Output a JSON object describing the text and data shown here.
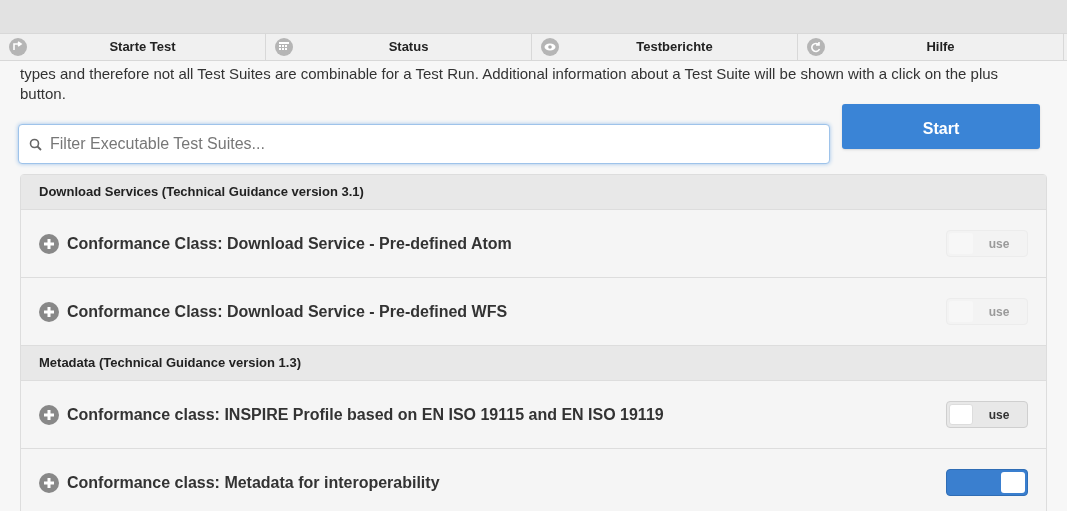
{
  "tabs": [
    {
      "label": "Starte Test"
    },
    {
      "label": "Status"
    },
    {
      "label": "Testberichte"
    },
    {
      "label": "Hilfe"
    }
  ],
  "intro": "types and therefore not all Test Suites are combinable for a Test Run. Additional information about a Test Suite will be shown with a click on the plus button.",
  "filter": {
    "placeholder": "Filter Executable Test Suites..."
  },
  "start_button": "Start",
  "groups": [
    {
      "title": "Download Services (Technical Guidance version 3.1)",
      "suites": [
        {
          "name": "Conformance Class: Download Service - Pre-defined Atom",
          "toggle": "use",
          "disabled": true,
          "on": false
        },
        {
          "name": "Conformance Class: Download Service - Pre-defined WFS",
          "toggle": "use",
          "disabled": true,
          "on": false
        }
      ]
    },
    {
      "title": "Metadata (Technical Guidance version 1.3)",
      "suites": [
        {
          "name": "Conformance class: INSPIRE Profile based on EN ISO 19115 and EN ISO 19119",
          "toggle": "use",
          "disabled": false,
          "on": false
        },
        {
          "name": "Conformance class: Metadata for interoperability",
          "disabled": false,
          "on": true
        }
      ]
    }
  ]
}
